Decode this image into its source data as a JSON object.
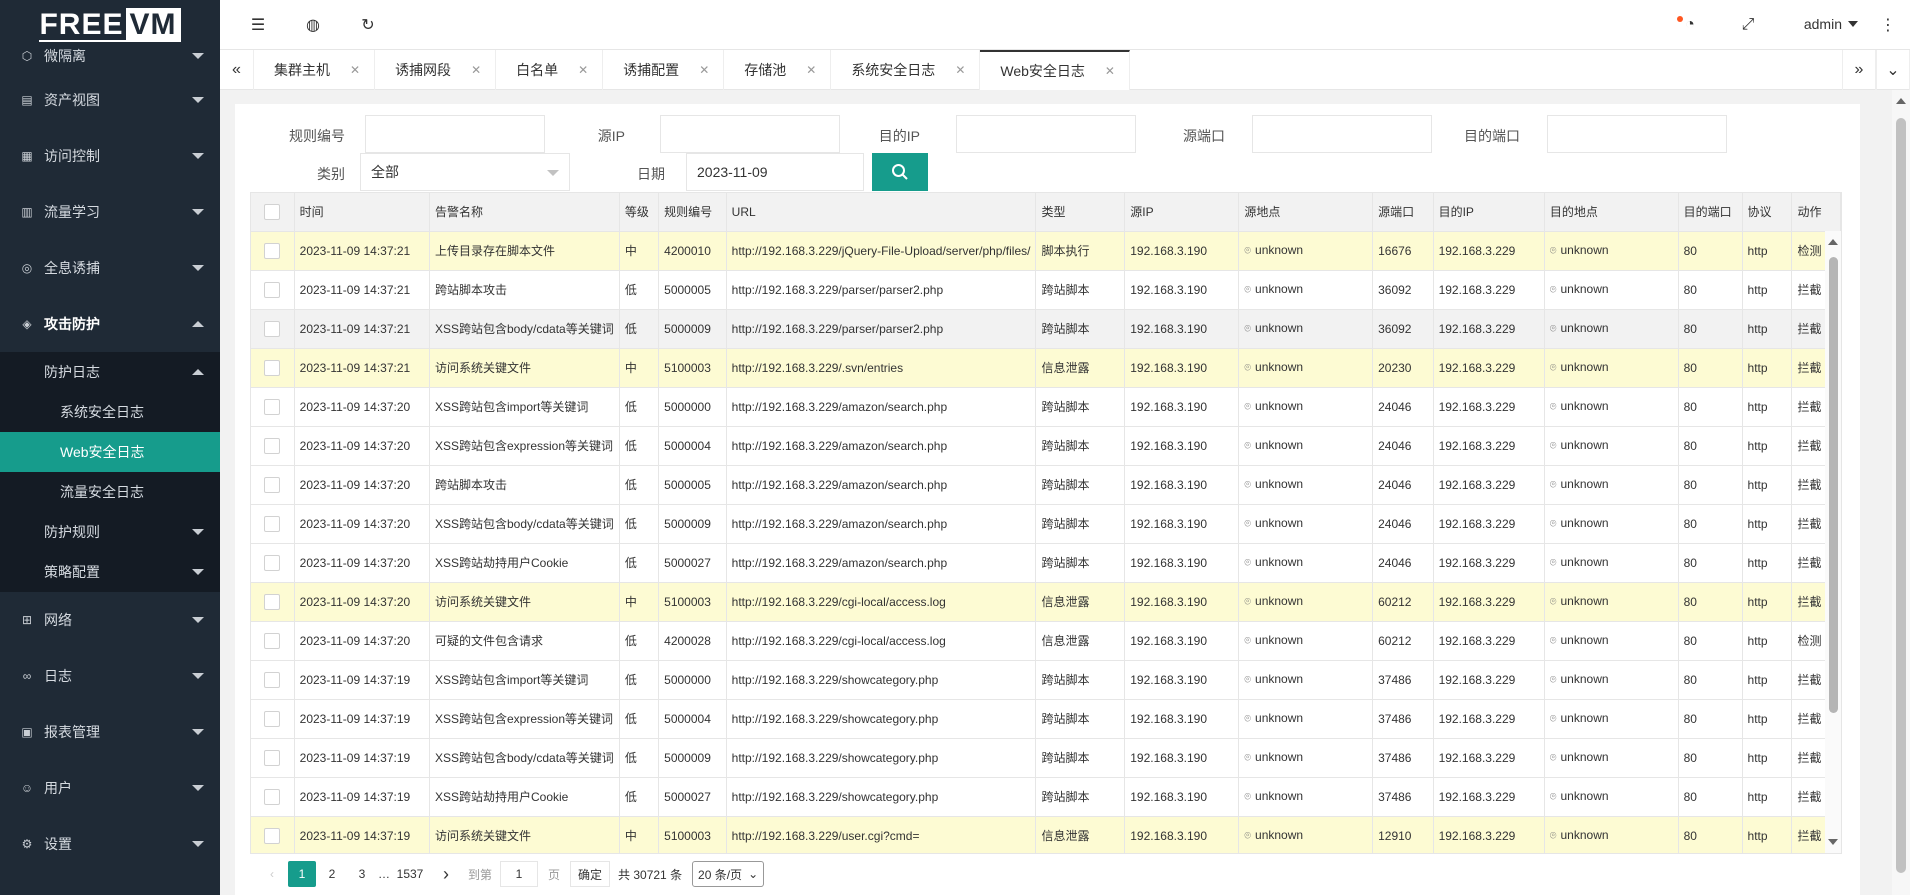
{
  "logo": {
    "free": "FREE",
    "vm": "VM"
  },
  "sidebar": {
    "items": [
      {
        "label": "微隔离",
        "icon": "cube-icon"
      },
      {
        "label": "资产视图",
        "icon": "server-icon"
      },
      {
        "label": "访问控制",
        "icon": "grid-icon"
      },
      {
        "label": "流量学习",
        "icon": "chart-icon"
      },
      {
        "label": "全息诱捕",
        "icon": "target-icon"
      },
      {
        "label": "攻击防护",
        "icon": "binoculars-icon"
      }
    ],
    "attack_sub": {
      "protect_log": "防护日志",
      "logs": [
        "系统安全日志",
        "Web安全日志",
        "流量安全日志"
      ],
      "rules": "防护规则",
      "policy": "策略配置"
    },
    "bottom_items": [
      {
        "label": "网络",
        "icon": "network-icon"
      },
      {
        "label": "日志",
        "icon": "link-icon"
      },
      {
        "label": "报表管理",
        "icon": "report-icon"
      },
      {
        "label": "用户",
        "icon": "user-icon"
      },
      {
        "label": "设置",
        "icon": "gear-icon"
      }
    ]
  },
  "header": {
    "user": "admin"
  },
  "tabs": [
    "集群主机",
    "诱捕网段",
    "白名单",
    "诱捕配置",
    "存储池",
    "系统安全日志",
    "Web安全日志"
  ],
  "filters": {
    "rule_no": "规则编号",
    "src_ip": "源IP",
    "dst_ip": "目的IP",
    "src_port": "源端口",
    "dst_port": "目的端口",
    "category": "类别",
    "category_value": "全部",
    "date": "日期",
    "date_value": "2023-11-09"
  },
  "table": {
    "headers": [
      "时间",
      "告警名称",
      "等级",
      "规则编号",
      "URL",
      "类型",
      "源IP",
      "源地点",
      "源端口",
      "目的IP",
      "目的地点",
      "目的端口",
      "协议",
      "动作"
    ],
    "rows": [
      [
        "2023-11-09 14:37:21",
        "上传目录存在脚本文件",
        "中",
        "4200010",
        "http://192.168.3.229/jQuery-File-Upload/server/php/files/",
        "脚本执行",
        "192.168.3.190",
        "unknown",
        "16676",
        "192.168.3.229",
        "unknown",
        "80",
        "http",
        "检测"
      ],
      [
        "2023-11-09 14:37:21",
        "跨站脚本攻击",
        "低",
        "5000005",
        "http://192.168.3.229/parser/parser2.php",
        "跨站脚本",
        "192.168.3.190",
        "unknown",
        "36092",
        "192.168.3.229",
        "unknown",
        "80",
        "http",
        "拦截"
      ],
      [
        "2023-11-09 14:37:21",
        "XSS跨站包含body/cdata等关键词",
        "低",
        "5000009",
        "http://192.168.3.229/parser/parser2.php",
        "跨站脚本",
        "192.168.3.190",
        "unknown",
        "36092",
        "192.168.3.229",
        "unknown",
        "80",
        "http",
        "拦截"
      ],
      [
        "2023-11-09 14:37:21",
        "访问系统关键文件",
        "中",
        "5100003",
        "http://192.168.3.229/.svn/entries",
        "信息泄露",
        "192.168.3.190",
        "unknown",
        "20230",
        "192.168.3.229",
        "unknown",
        "80",
        "http",
        "拦截"
      ],
      [
        "2023-11-09 14:37:20",
        "XSS跨站包含import等关键词",
        "低",
        "5000000",
        "http://192.168.3.229/amazon/search.php",
        "跨站脚本",
        "192.168.3.190",
        "unknown",
        "24046",
        "192.168.3.229",
        "unknown",
        "80",
        "http",
        "拦截"
      ],
      [
        "2023-11-09 14:37:20",
        "XSS跨站包含expression等关键词",
        "低",
        "5000004",
        "http://192.168.3.229/amazon/search.php",
        "跨站脚本",
        "192.168.3.190",
        "unknown",
        "24046",
        "192.168.3.229",
        "unknown",
        "80",
        "http",
        "拦截"
      ],
      [
        "2023-11-09 14:37:20",
        "跨站脚本攻击",
        "低",
        "5000005",
        "http://192.168.3.229/amazon/search.php",
        "跨站脚本",
        "192.168.3.190",
        "unknown",
        "24046",
        "192.168.3.229",
        "unknown",
        "80",
        "http",
        "拦截"
      ],
      [
        "2023-11-09 14:37:20",
        "XSS跨站包含body/cdata等关键词",
        "低",
        "5000009",
        "http://192.168.3.229/amazon/search.php",
        "跨站脚本",
        "192.168.3.190",
        "unknown",
        "24046",
        "192.168.3.229",
        "unknown",
        "80",
        "http",
        "拦截"
      ],
      [
        "2023-11-09 14:37:20",
        "XSS跨站劫持用户Cookie",
        "低",
        "5000027",
        "http://192.168.3.229/amazon/search.php",
        "跨站脚本",
        "192.168.3.190",
        "unknown",
        "24046",
        "192.168.3.229",
        "unknown",
        "80",
        "http",
        "拦截"
      ],
      [
        "2023-11-09 14:37:20",
        "访问系统关键文件",
        "中",
        "5100003",
        "http://192.168.3.229/cgi-local/access.log",
        "信息泄露",
        "192.168.3.190",
        "unknown",
        "60212",
        "192.168.3.229",
        "unknown",
        "80",
        "http",
        "拦截"
      ],
      [
        "2023-11-09 14:37:20",
        "可疑的文件包含请求",
        "低",
        "4200028",
        "http://192.168.3.229/cgi-local/access.log",
        "信息泄露",
        "192.168.3.190",
        "unknown",
        "60212",
        "192.168.3.229",
        "unknown",
        "80",
        "http",
        "检测"
      ],
      [
        "2023-11-09 14:37:19",
        "XSS跨站包含import等关键词",
        "低",
        "5000000",
        "http://192.168.3.229/showcategory.php",
        "跨站脚本",
        "192.168.3.190",
        "unknown",
        "37486",
        "192.168.3.229",
        "unknown",
        "80",
        "http",
        "拦截"
      ],
      [
        "2023-11-09 14:37:19",
        "XSS跨站包含expression等关键词",
        "低",
        "5000004",
        "http://192.168.3.229/showcategory.php",
        "跨站脚本",
        "192.168.3.190",
        "unknown",
        "37486",
        "192.168.3.229",
        "unknown",
        "80",
        "http",
        "拦截"
      ],
      [
        "2023-11-09 14:37:19",
        "XSS跨站包含body/cdata等关键词",
        "低",
        "5000009",
        "http://192.168.3.229/showcategory.php",
        "跨站脚本",
        "192.168.3.190",
        "unknown",
        "37486",
        "192.168.3.229",
        "unknown",
        "80",
        "http",
        "拦截"
      ],
      [
        "2023-11-09 14:37:19",
        "XSS跨站劫持用户Cookie",
        "低",
        "5000027",
        "http://192.168.3.229/showcategory.php",
        "跨站脚本",
        "192.168.3.190",
        "unknown",
        "37486",
        "192.168.3.229",
        "unknown",
        "80",
        "http",
        "拦截"
      ],
      [
        "2023-11-09 14:37:19",
        "访问系统关键文件",
        "中",
        "5100003",
        "http://192.168.3.229/user.cgi?cmd=",
        "信息泄露",
        "192.168.3.190",
        "unknown",
        "12910",
        "192.168.3.229",
        "unknown",
        "80",
        "http",
        "拦截"
      ]
    ],
    "highlight_rows": [
      0,
      3,
      9,
      15
    ],
    "gray_rows": [
      2
    ]
  },
  "pager": {
    "pages": [
      "1",
      "2",
      "3"
    ],
    "ellipsis": "…",
    "last": "1537",
    "goto": "到第",
    "goto_value": "1",
    "page_unit": "页",
    "confirm": "确定",
    "total": "共 30721 条",
    "per_page": "20 条/页"
  },
  "colors": {
    "accent": "#169c8c",
    "sidebar": "#1f2a36",
    "highlight": "#fdfbd3"
  }
}
